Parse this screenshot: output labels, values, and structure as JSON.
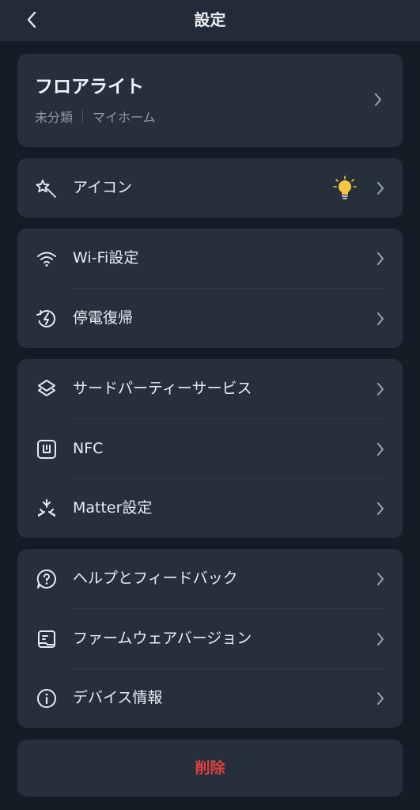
{
  "header": {
    "title": "設定",
    "back_icon": "chevron-left-icon"
  },
  "device": {
    "name": "フロアライト",
    "category": "未分類",
    "home": "マイホーム"
  },
  "icon_setting": {
    "label": "アイコン",
    "preview_icon": "lightbulb-icon",
    "preview_color": "#f6c543"
  },
  "network_group": [
    {
      "label": "Wi-Fi設定",
      "icon": "wifi-icon"
    },
    {
      "label": "停電復帰",
      "icon": "power-restore-icon"
    }
  ],
  "integration_group": [
    {
      "label": "サードパーティーサービス",
      "icon": "layers-icon"
    },
    {
      "label": "NFC",
      "icon": "nfc-icon"
    },
    {
      "label": "Matter設定",
      "icon": "matter-icon"
    }
  ],
  "support_group": [
    {
      "label": "ヘルプとフィードバック",
      "icon": "help-icon"
    },
    {
      "label": "ファームウェアバージョン",
      "icon": "firmware-icon"
    },
    {
      "label": "デバイス情報",
      "icon": "info-icon"
    }
  ],
  "delete": {
    "label": "削除",
    "color": "#e2403f"
  },
  "colors": {
    "background": "#161c25",
    "card": "#26303d",
    "header": "#222b37"
  }
}
